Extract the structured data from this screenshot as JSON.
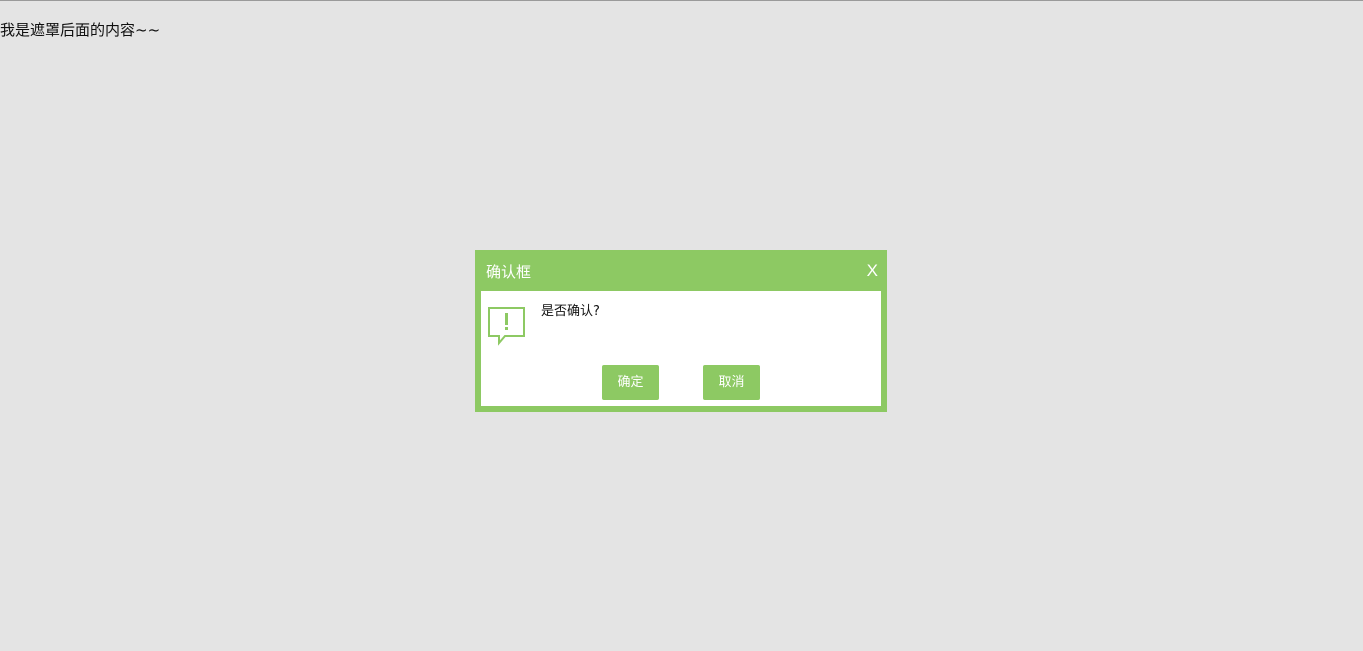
{
  "page": {
    "background_text": "我是遮罩后面的内容~~"
  },
  "dialog": {
    "title": "确认框",
    "close_label": "X",
    "message": "是否确认?",
    "icon": "alert-speech-bubble-icon",
    "confirm_label": "确定",
    "cancel_label": "取消"
  },
  "colors": {
    "accent": "#8dc963",
    "overlay": "#e5e5e5",
    "dialog_body": "#ffffff"
  }
}
